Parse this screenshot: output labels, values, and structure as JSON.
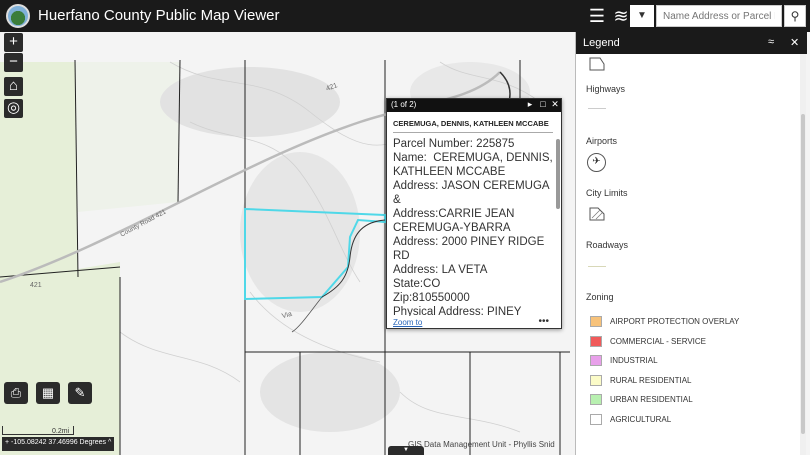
{
  "header": {
    "title": "Huerfano County Public Map Viewer",
    "search_placeholder": "Name Address or Parcel Nu"
  },
  "map": {
    "labels": {
      "road_421_top": "421",
      "county_road": "County Road 421",
      "road_421_left": "421",
      "small_road": "Via"
    },
    "coordinates": "-105.08242 37.46996 Degrees",
    "scale_label": "0.2mi",
    "attribution": "GIS Data Management Unit - Phyllis Snid"
  },
  "popup": {
    "count": "(1 of 2)",
    "title": "CEREMUGA, DENNIS, KATHLEEN MCCABE",
    "lines": [
      "Parcel Number: 225875",
      "Name:  CEREMUGA, DENNIS, KATHLEEN MCCABE",
      "Address: JASON CEREMUGA &",
      "Address:CARRIE JEAN CEREMUGA-YBARRA",
      "Address: 2000 PINEY RIDGE RD",
      "Address: LA VETA",
      "State:CO",
      "Zip:810550000",
      "Physical Address: PINEY"
    ],
    "zoom_to": "Zoom to",
    "more": "•••"
  },
  "legend": {
    "title": "Legend",
    "sections": {
      "highways": "Highways",
      "airports": "Airports",
      "city_limits": "City Limits",
      "roadways": "Roadways",
      "zoning": "Zoning"
    },
    "zoning_items": [
      {
        "label": "AIRPORT PROTECTION OVERLAY",
        "color": "#f7c27a"
      },
      {
        "label": "COMMERCIAL - SERVICE",
        "color": "#f05a5a"
      },
      {
        "label": "INDUSTRIAL",
        "color": "#e8a0ea"
      },
      {
        "label": "RURAL RESIDENTIAL",
        "color": "#fbfbc8"
      },
      {
        "label": "URBAN RESIDENTIAL",
        "color": "#b8f0b0"
      },
      {
        "label": "AGRICULTURAL",
        "color": "#ffffff"
      }
    ]
  },
  "colors": {
    "selected_parcel": "#4fd8e8",
    "parcel_lines": "#222222",
    "agricultural_tint": "#e8f0dc"
  }
}
